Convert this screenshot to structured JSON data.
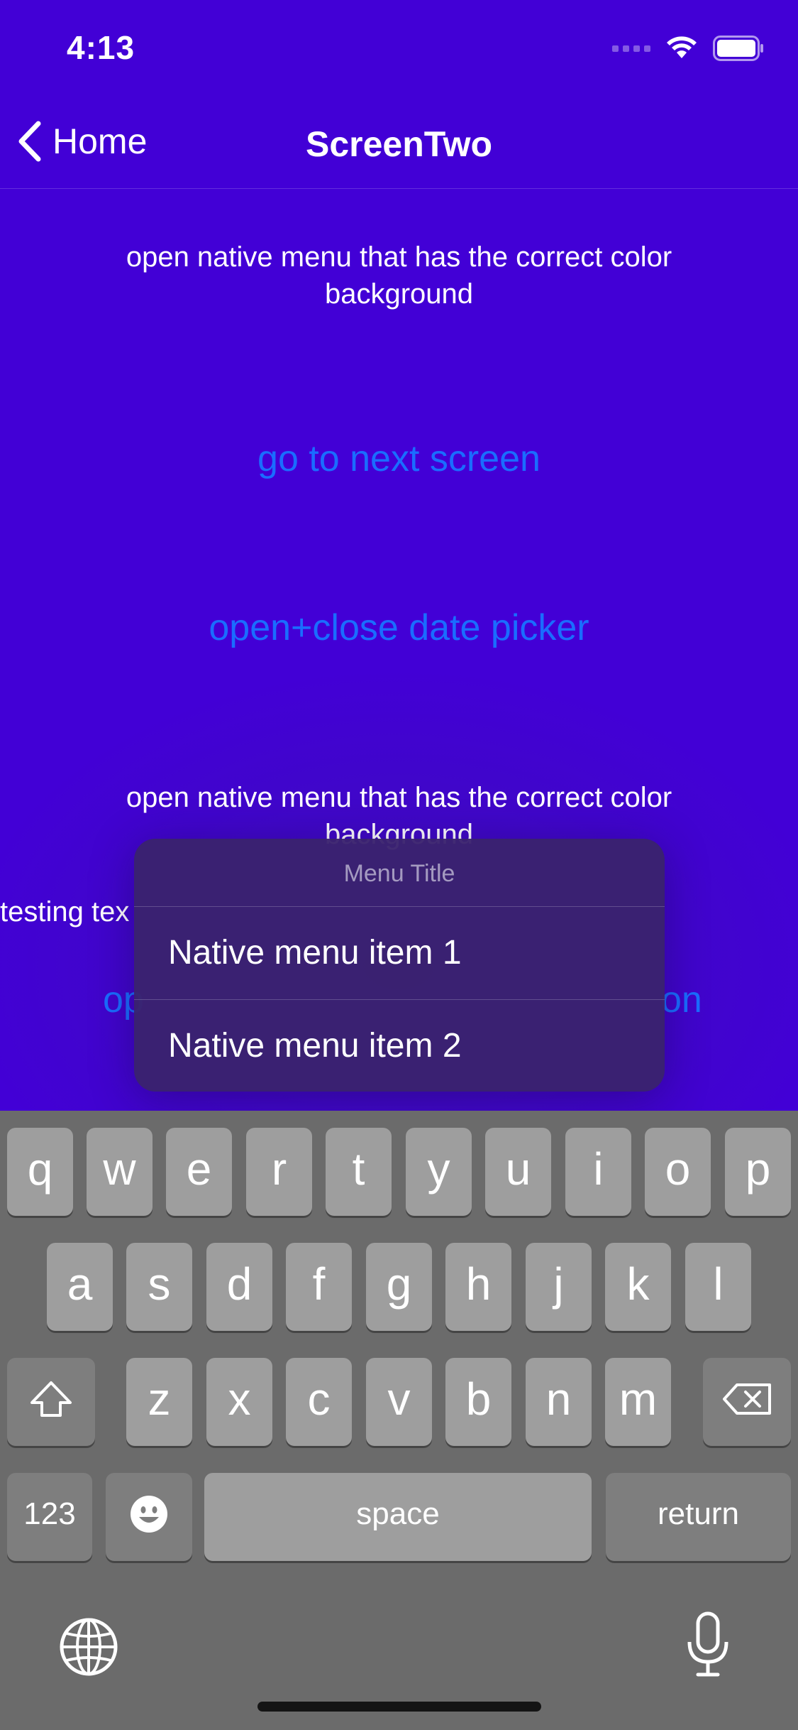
{
  "status": {
    "time": "4:13"
  },
  "nav": {
    "back_label": "Home",
    "title": "ScreenTwo"
  },
  "content": {
    "text_1": "open native menu that has the correct color background",
    "link_next": "go to next screen",
    "link_date": "open+close date picker",
    "text_2": "open native menu that has the correct color background",
    "testing": "testing tex",
    "link_partial_left": "op",
    "link_partial_right": "on"
  },
  "menu": {
    "title": "Menu Title",
    "items": [
      "Native menu item 1",
      "Native menu item 2"
    ]
  },
  "keyboard": {
    "row1": [
      "q",
      "w",
      "e",
      "r",
      "t",
      "y",
      "u",
      "i",
      "o",
      "p"
    ],
    "row2": [
      "a",
      "s",
      "d",
      "f",
      "g",
      "h",
      "j",
      "k",
      "l"
    ],
    "row3": [
      "z",
      "x",
      "c",
      "v",
      "b",
      "n",
      "m"
    ],
    "numbers_label": "123",
    "space_label": "space",
    "return_label": "return"
  },
  "colors": {
    "background": "#4200D6",
    "link": "#1a6dff",
    "keyboard": "#6b6b6b"
  }
}
